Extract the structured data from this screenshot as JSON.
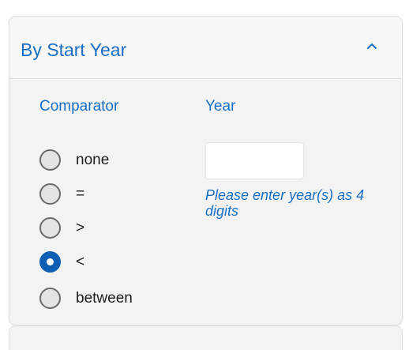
{
  "panel": {
    "title": "By Start Year",
    "expanded": true,
    "toggle_icon": "chevron-up-icon"
  },
  "comparator": {
    "label": "Comparator",
    "options": [
      {
        "label": "none",
        "selected": false
      },
      {
        "label": "=",
        "selected": false
      },
      {
        "label": ">",
        "selected": false
      },
      {
        "label": "<",
        "selected": true
      },
      {
        "label": "between",
        "selected": false
      }
    ]
  },
  "year": {
    "label": "Year",
    "value": "",
    "hint": "Please enter year(s) as 4 digits"
  },
  "colors": {
    "accent": "#1a6fc4",
    "radio_selected": "#0e5fb3",
    "panel_bg": "#f3f3f3"
  }
}
